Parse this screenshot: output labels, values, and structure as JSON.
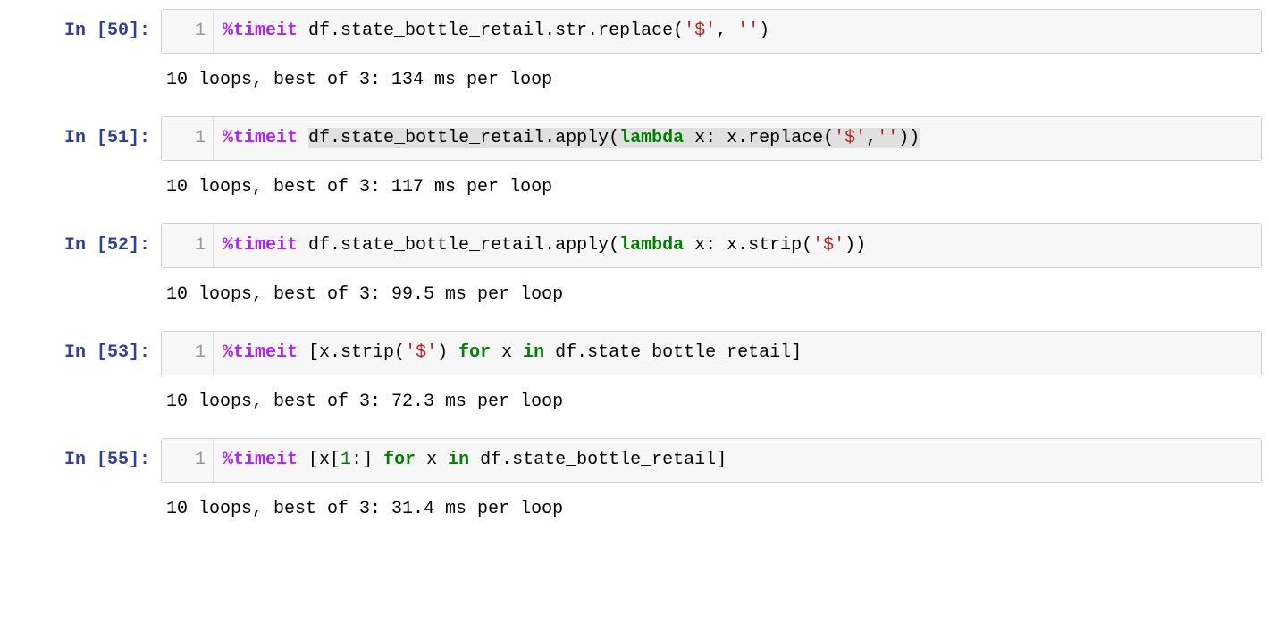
{
  "cells": [
    {
      "prompt": "In [50]:",
      "lineno": "1",
      "tokens": [
        {
          "cls": "tok-magic",
          "t": "%"
        },
        {
          "cls": "tok-magic",
          "t": "timeit"
        },
        {
          "cls": "tok-plain",
          "t": " df.state_bottle_retail.str.replace("
        },
        {
          "cls": "tok-str",
          "t": "'$'"
        },
        {
          "cls": "tok-plain",
          "t": ", "
        },
        {
          "cls": "tok-str",
          "t": "''"
        },
        {
          "cls": "tok-plain",
          "t": ")"
        }
      ],
      "output": "10 loops, best of 3: 134 ms per loop"
    },
    {
      "prompt": "In [51]:",
      "lineno": "1",
      "tokens": [
        {
          "cls": "tok-magic",
          "t": "%"
        },
        {
          "cls": "tok-magic",
          "t": "timeit"
        },
        {
          "cls": "tok-plain",
          "t": " "
        },
        {
          "cls": "tok-plain tok-hl",
          "t": "df.state_bottle_retail.apply("
        },
        {
          "cls": "tok-kw tok-hl",
          "t": "lambda"
        },
        {
          "cls": "tok-plain tok-hl",
          "t": " x: x.replace("
        },
        {
          "cls": "tok-str tok-hl",
          "t": "'$'"
        },
        {
          "cls": "tok-plain tok-hl",
          "t": ","
        },
        {
          "cls": "tok-str tok-hl",
          "t": "''"
        },
        {
          "cls": "tok-plain tok-hl",
          "t": "))"
        }
      ],
      "output": "10 loops, best of 3: 117 ms per loop"
    },
    {
      "prompt": "In [52]:",
      "lineno": "1",
      "tokens": [
        {
          "cls": "tok-magic",
          "t": "%"
        },
        {
          "cls": "tok-magic",
          "t": "timeit"
        },
        {
          "cls": "tok-plain",
          "t": " df.state_bottle_retail.apply("
        },
        {
          "cls": "tok-kw",
          "t": "lambda"
        },
        {
          "cls": "tok-plain",
          "t": " x: x.strip("
        },
        {
          "cls": "tok-str",
          "t": "'$'"
        },
        {
          "cls": "tok-plain",
          "t": "))"
        }
      ],
      "output": "10 loops, best of 3: 99.5 ms per loop"
    },
    {
      "prompt": "In [53]:",
      "lineno": "1",
      "tokens": [
        {
          "cls": "tok-magic",
          "t": "%"
        },
        {
          "cls": "tok-magic",
          "t": "timeit"
        },
        {
          "cls": "tok-plain",
          "t": " [x.strip("
        },
        {
          "cls": "tok-str",
          "t": "'$'"
        },
        {
          "cls": "tok-plain",
          "t": ") "
        },
        {
          "cls": "tok-kw",
          "t": "for"
        },
        {
          "cls": "tok-plain",
          "t": " x "
        },
        {
          "cls": "tok-kw",
          "t": "in"
        },
        {
          "cls": "tok-plain",
          "t": " df.state_bottle_retail]"
        }
      ],
      "output": "10 loops, best of 3: 72.3 ms per loop"
    },
    {
      "prompt": "In [55]:",
      "lineno": "1",
      "tokens": [
        {
          "cls": "tok-magic",
          "t": "%"
        },
        {
          "cls": "tok-magic",
          "t": "timeit"
        },
        {
          "cls": "tok-plain",
          "t": " [x["
        },
        {
          "cls": "tok-num",
          "t": "1"
        },
        {
          "cls": "tok-plain",
          "t": ":] "
        },
        {
          "cls": "tok-kw",
          "t": "for"
        },
        {
          "cls": "tok-plain",
          "t": " x "
        },
        {
          "cls": "tok-kw",
          "t": "in"
        },
        {
          "cls": "tok-plain",
          "t": " df.state_bottle_retail]"
        }
      ],
      "output": "10 loops, best of 3: 31.4 ms per loop"
    }
  ]
}
